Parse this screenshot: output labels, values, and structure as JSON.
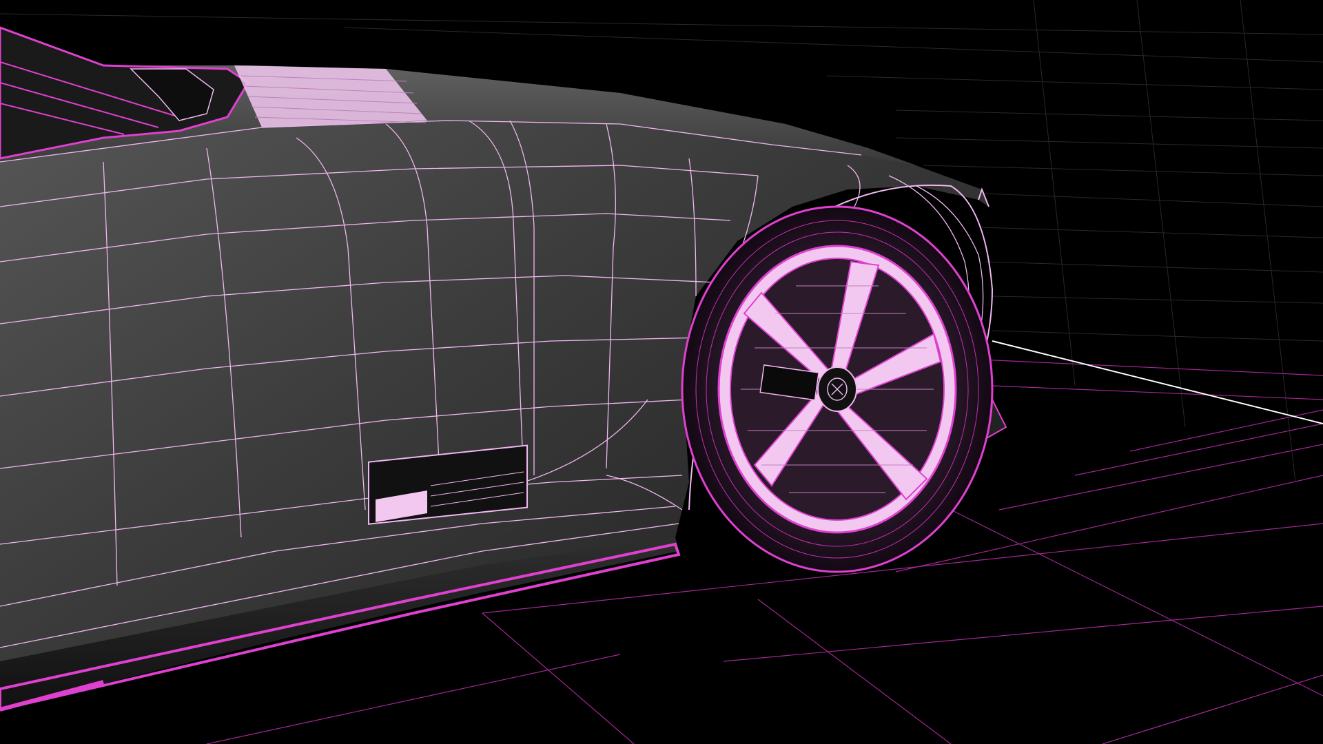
{
  "scene": {
    "subject": "car-wireframe-render",
    "background_color": "#000000",
    "body_color": "#3a3a3a",
    "wireframe_color": "#f0b8f0",
    "accent_color": "#e040d0",
    "floor_grid_color": "#c030b0",
    "icons": [
      "front-wheel-icon",
      "wheel-hub-icon",
      "side-mirror-icon"
    ]
  }
}
